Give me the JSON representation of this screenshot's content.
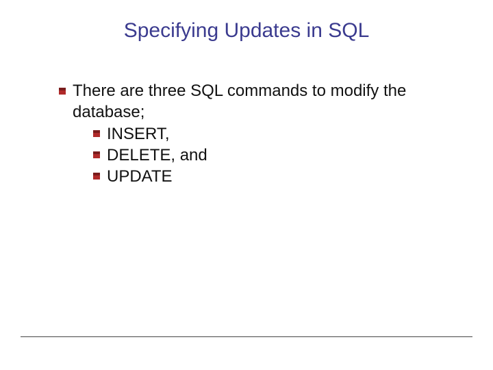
{
  "title": "Specifying Updates in SQL",
  "main_bullet": "There are three SQL commands to modify the database;",
  "sub_bullets": {
    "a": "INSERT,",
    "b": "DELETE, and",
    "c": "UPDATE"
  }
}
